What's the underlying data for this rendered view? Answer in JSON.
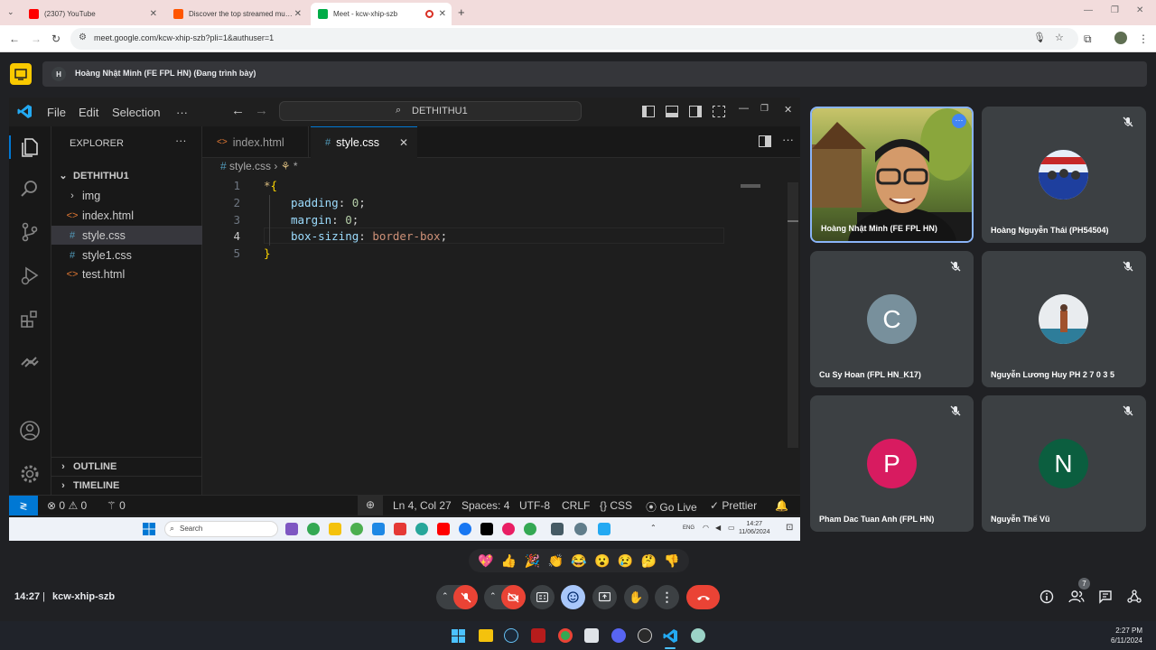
{
  "browser": {
    "tabs": [
      {
        "title": "(2307) YouTube",
        "favicon_color": "#ff0000"
      },
      {
        "title": "Discover the top streamed mu…",
        "favicon_color": "#ff5500"
      },
      {
        "title": "Meet - kcw-xhip-szb",
        "favicon_color": "#00ac47"
      }
    ],
    "new_tab": "+",
    "url": "meet.google.com/kcw-xhip-szb?pli=1&authuser=1"
  },
  "meet": {
    "presenter_initial": "H",
    "presenter_text": "Hoàng Nhật Minh (FE FPL HN) (Đang trình bày)",
    "participants": [
      {
        "name": "Hoàng Nhật Minh (FE FPL HN)",
        "type": "video"
      },
      {
        "name": "Hoàng Nguyễn Thái (PH54504)",
        "type": "photo"
      },
      {
        "name": "Cu Sy Hoan (FPL HN_K17)",
        "initial": "C",
        "color": "#78909c"
      },
      {
        "name": "Nguyễn Lương Huy PH 2 7 0 3 5",
        "type": "photo"
      },
      {
        "name": "Pham Dac Tuan Anh (FPL HN)",
        "initial": "P",
        "color": "#d81b60"
      },
      {
        "name": "Nguyễn Thế Vũ",
        "initial": "N",
        "color": "#0b5e3f"
      }
    ],
    "time": "14:27",
    "meeting_code": "kcw-xhip-szb",
    "people_count": "7",
    "reactions": [
      "💖",
      "👍",
      "🎉",
      "👏",
      "😂",
      "😮",
      "😢",
      "🤔",
      "👎"
    ]
  },
  "vscode": {
    "menu": [
      "File",
      "Edit",
      "Selection",
      "···"
    ],
    "command_center": "DETHITHU1",
    "explorer_title": "EXPLORER",
    "folder": "DETHITHU1",
    "files": [
      {
        "name": "img",
        "kind": "folder"
      },
      {
        "name": "index.html",
        "kind": "html"
      },
      {
        "name": "style.css",
        "kind": "css"
      },
      {
        "name": "style1.css",
        "kind": "css"
      },
      {
        "name": "test.html",
        "kind": "html"
      }
    ],
    "outline": "OUTLINE",
    "timeline": "TIMELINE",
    "tabs": [
      "index.html",
      "style.css"
    ],
    "breadcrumb_file": "style.css",
    "breadcrumb_symbol": "*",
    "line_numbers": [
      "1",
      "2",
      "3",
      "4",
      "5"
    ],
    "code": {
      "selector": "*",
      "open_brace": "{",
      "close_brace": "}",
      "decl1_prop": "padding",
      "decl1_val": "0",
      "decl2_prop": "margin",
      "decl2_val": "0",
      "decl3_prop": "box-sizing",
      "decl3_val": "border-box",
      "colon": ": ",
      "semi": ";"
    },
    "status": {
      "errors": "0",
      "warnings": "0",
      "ports": "0",
      "position": "Ln 4, Col 27",
      "spaces": "Spaces: 4",
      "encoding": "UTF-8",
      "eol": "CRLF",
      "language": "CSS",
      "golive": "Go Live",
      "prettier": "Prettier"
    }
  },
  "inner_taskbar": {
    "search": "Search",
    "time": "14:27",
    "date": "11/06/2024",
    "lang": "ENG"
  },
  "host_taskbar": {
    "time": "2:27 PM",
    "date": "6/11/2024"
  }
}
